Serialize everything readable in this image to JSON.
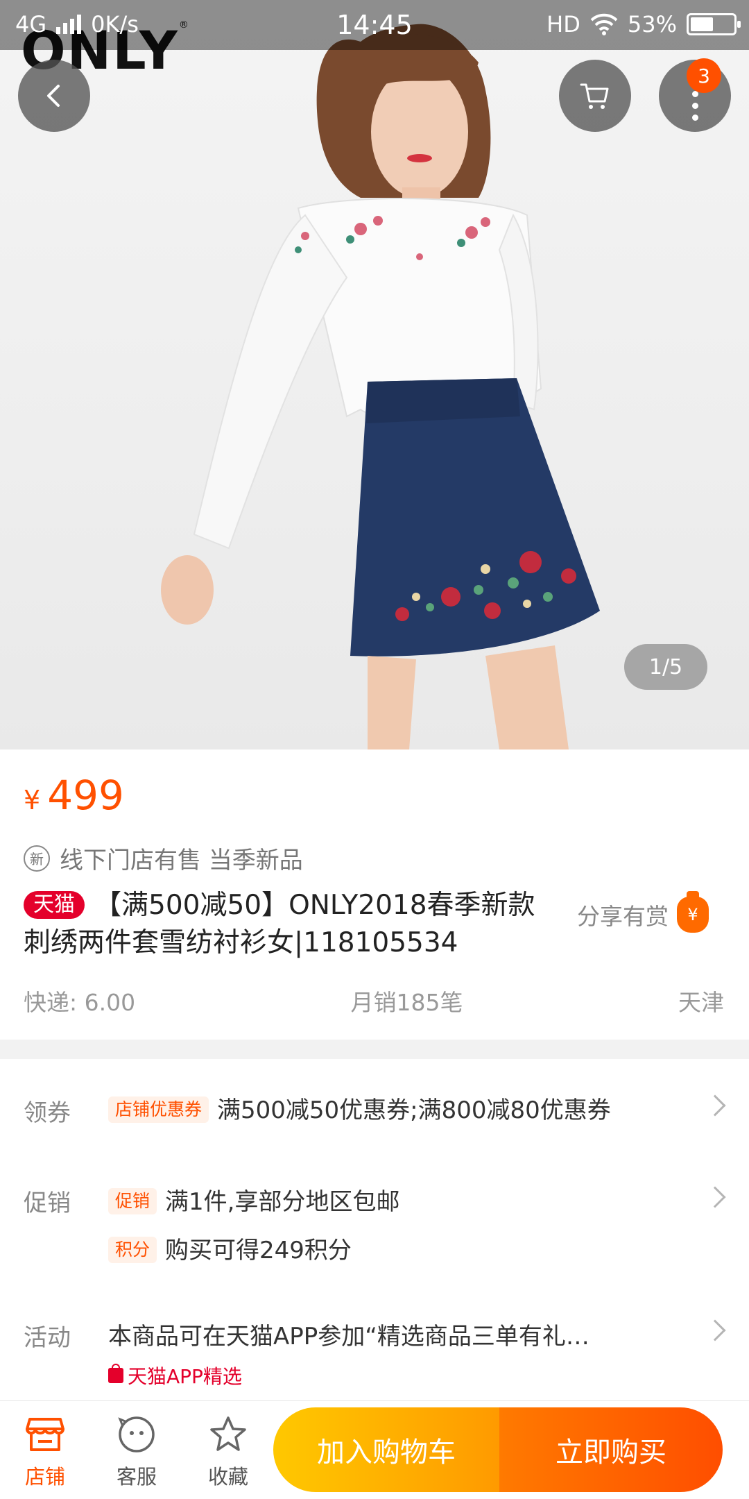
{
  "status_bar": {
    "network": "4G",
    "speed": "0K/s",
    "time": "14:45",
    "hd": "HD",
    "battery_text": "53%",
    "battery_level": 0.53
  },
  "hero": {
    "brand": "ONLY",
    "pager": "1/5",
    "cart_badge": "3"
  },
  "product": {
    "price_symbol": "¥",
    "price": "499",
    "new_icon": "新",
    "tags_line": "线下门店有售 当季新品",
    "platform_tag": "天猫",
    "title": "【满500减50】ONLY2018春季新款刺绣两件套雪纺衬衫女|118105534",
    "share_label": "分享有赏",
    "share_icon_glyph": "¥",
    "shipping": "快递: 6.00",
    "monthly_sales": "月销185笔",
    "location": "天津"
  },
  "coupon": {
    "label": "领券",
    "pill": "店铺优惠券",
    "text": "满500减50优惠券;满800减80优惠券"
  },
  "promo": {
    "label": "促销",
    "items": [
      {
        "pill": "促销",
        "text": "满1件,享部分地区包邮"
      },
      {
        "pill": "积分",
        "text": "购买可得249积分"
      }
    ]
  },
  "activity": {
    "label": "活动",
    "text": "本商品可在天猫APP参加“精选商品三单有礼…",
    "sub": "天猫APP精选"
  },
  "bottom_bar": {
    "shop": "店铺",
    "service": "客服",
    "favorite": "收藏",
    "add_to_cart": "加入购物车",
    "buy_now": "立即购买"
  },
  "colors": {
    "accent": "#ff5000",
    "tmall_red": "#e4002b",
    "cart_gradient_start": "#ffc800",
    "buy_gradient_end": "#ff4e00"
  }
}
